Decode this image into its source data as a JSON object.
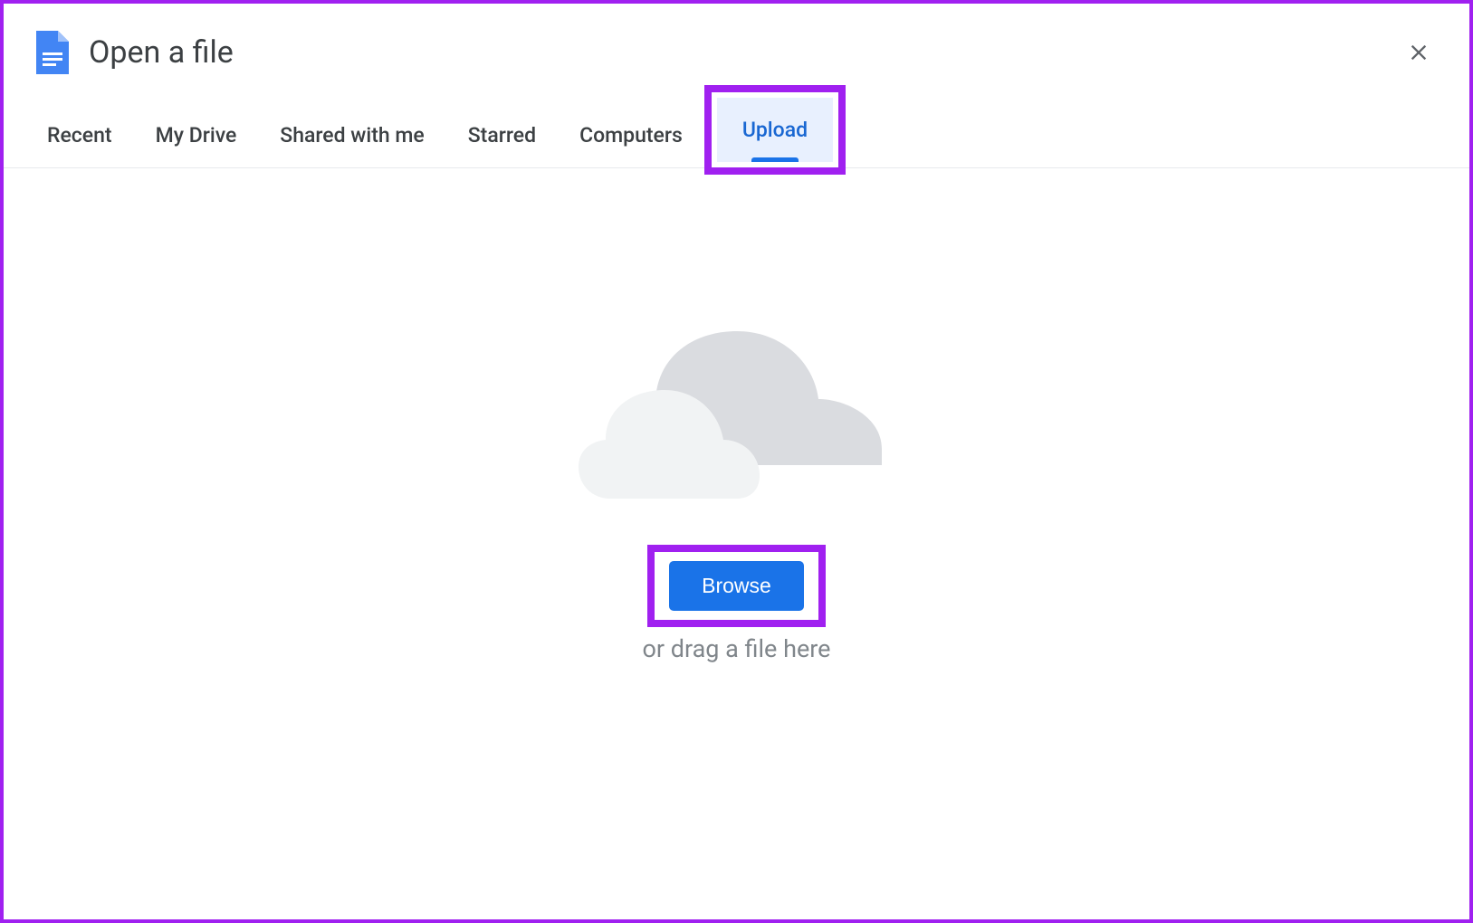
{
  "header": {
    "title": "Open a file"
  },
  "tabs": [
    {
      "label": "Recent"
    },
    {
      "label": "My Drive"
    },
    {
      "label": "Shared with me"
    },
    {
      "label": "Starred"
    },
    {
      "label": "Computers"
    },
    {
      "label": "Upload"
    }
  ],
  "upload": {
    "browse_label": "Browse",
    "drag_text": "or drag a file here"
  }
}
